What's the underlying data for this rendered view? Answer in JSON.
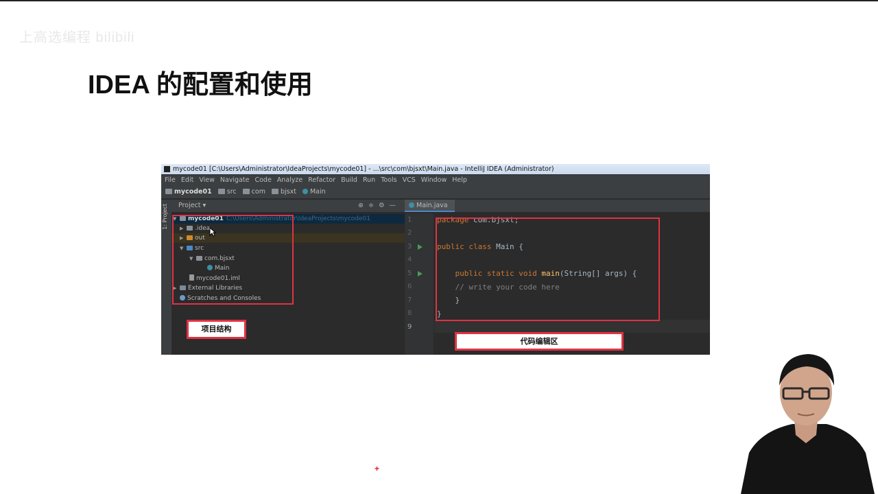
{
  "watermark": "上高选编程 bilibili",
  "slide_title": "IDEA 的配置和使用",
  "ide": {
    "window_title": "mycode01 [C:\\Users\\Administrator\\IdeaProjects\\mycode01] - ...\\src\\com\\bjsxt\\Main.java - IntelliJ IDEA (Administrator)",
    "menu": [
      "File",
      "Edit",
      "View",
      "Navigate",
      "Code",
      "Analyze",
      "Refactor",
      "Build",
      "Run",
      "Tools",
      "VCS",
      "Window",
      "Help"
    ],
    "breadcrumbs": [
      "mycode01",
      "src",
      "com",
      "bjsxt",
      "Main"
    ],
    "side_strip_label": "1: Project",
    "project_panel_title": "Project",
    "tree": {
      "root": "mycode01",
      "root_path": "C:\\Users\\Administrator\\IdeaProjects\\mycode01",
      "idea": ".idea",
      "out": "out",
      "src": "src",
      "package": "com.bjsxt",
      "main_class": "Main",
      "iml": "mycode01.iml",
      "external": "External Libraries",
      "scratches": "Scratches and Consoles"
    },
    "editor_tab": "Main.java",
    "line_numbers": [
      "1",
      "2",
      "3",
      "4",
      "5",
      "6",
      "7",
      "8",
      "9"
    ],
    "code": {
      "l1_kw": "package",
      "l1_rest": " com.bjsxt;",
      "l3_kw": "public class",
      "l3_rest": " Main {",
      "l5_kw": "    public static void",
      "l5_fn": " main",
      "l5_rest": "(String[] args) {",
      "l6": "    // write your code here",
      "l7": "    }",
      "l8": "}"
    }
  },
  "callouts": {
    "project_structure": "项目结构",
    "code_editor": "代码编辑区"
  },
  "colors": {
    "highlight_red": "#e03344",
    "ide_background": "#2b2b2b",
    "keyword": "#cc7832"
  }
}
